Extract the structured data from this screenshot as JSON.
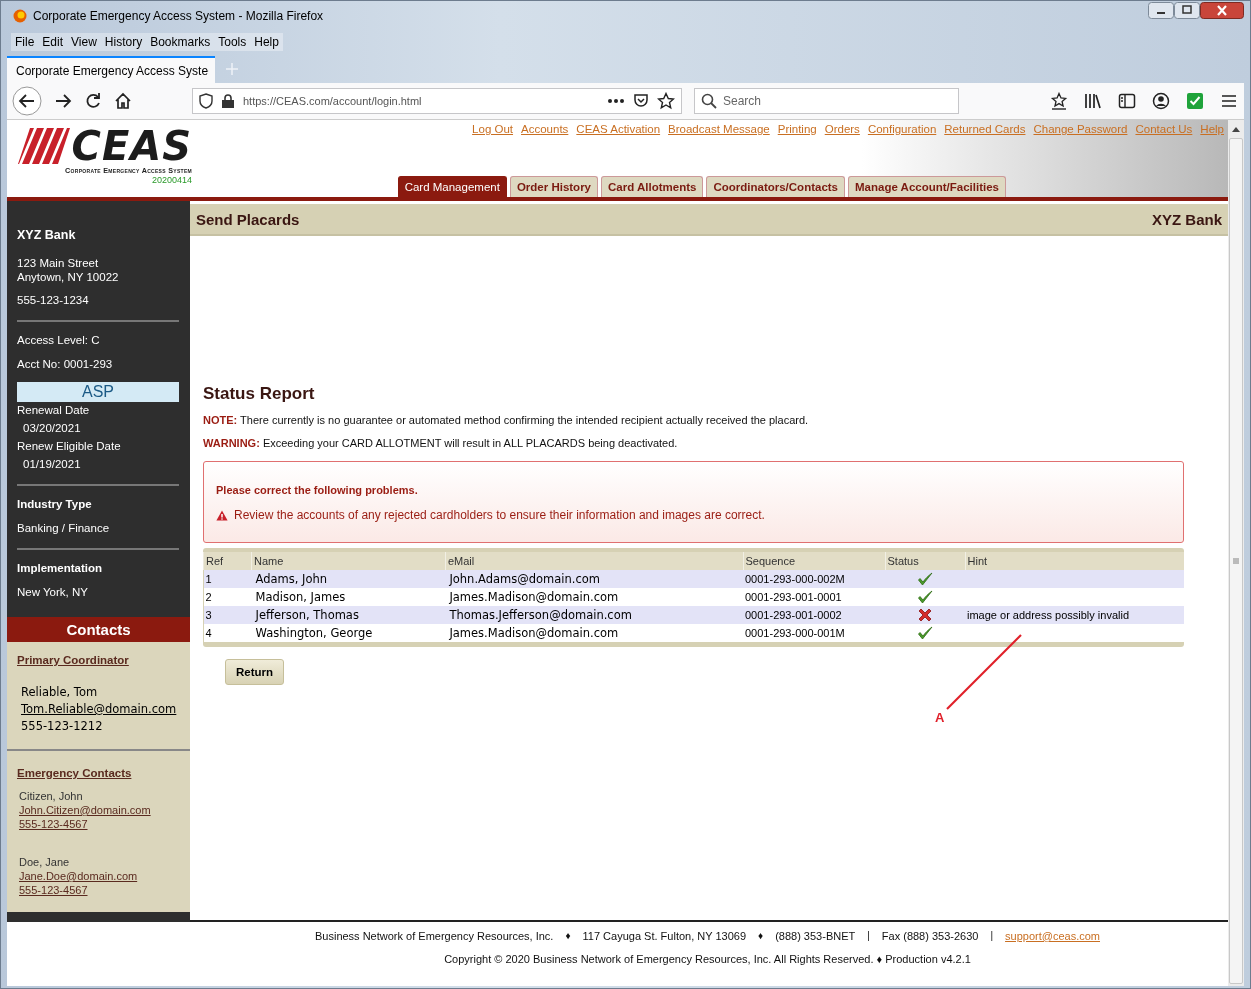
{
  "window": {
    "title": "Corporate Emergency Access System - Mozilla Firefox"
  },
  "menu": [
    "File",
    "Edit",
    "View",
    "History",
    "Bookmarks",
    "Tools",
    "Help"
  ],
  "browser_tab": {
    "label": "Corporate Emergency Access Syste",
    "selected": true
  },
  "nav": {
    "url": "https://CEAS.com/account/login.html",
    "search_placeholder": "Search"
  },
  "header": {
    "logo": "CEAS",
    "logo_subtitle": "Corporate Emergency Access System",
    "version": "20200414",
    "links": [
      "Log Out",
      "Accounts",
      "CEAS Activation",
      "Broadcast Message",
      "Printing",
      "Orders",
      "Configuration",
      "Returned Cards",
      "Change Password",
      "Contact Us",
      "Help"
    ],
    "tabs": [
      {
        "label": "Card Management",
        "selected": true
      },
      {
        "label": "Order History",
        "selected": false
      },
      {
        "label": "Card Allotments",
        "selected": false
      },
      {
        "label": "Coordinators/Contacts",
        "selected": false
      },
      {
        "label": "Manage Account/Facilities",
        "selected": false
      }
    ]
  },
  "page_title": "Send Placards",
  "account_name": "XYZ Bank",
  "sidebar": {
    "name": "XYZ Bank",
    "address": [
      "123 Main Street",
      "Anytown, NY 10022"
    ],
    "phone": "555-123-1234",
    "access_level": "Access Level: C",
    "acct_no": "Acct No: 0001-293",
    "badge": "ASP",
    "renewal_label": "Renewal Date",
    "renewal_date": "03/20/2021",
    "eligible_label": "Renew Eligible Date",
    "eligible_date": "01/19/2021",
    "industry_label": "Industry Type",
    "industry": "Banking / Finance",
    "impl_label": "Implementation",
    "impl": "New York, NY"
  },
  "contacts": {
    "title": "Contacts",
    "primary_label": "Primary Coordinator",
    "primary": {
      "name": "Reliable, Tom",
      "email": "Tom.Reliable@domain.com",
      "phone": "555-123-1212"
    },
    "emergency_label": "Emergency Contacts",
    "emergency": [
      {
        "name": "Citizen, John",
        "email": "John.Citizen@domain.com",
        "phone": "555-123-4567"
      },
      {
        "name": "Doe, Jane",
        "email": "Jane.Doe@domain.com",
        "phone": "555-123-4567"
      }
    ]
  },
  "report": {
    "title": "Status Report",
    "note_label": "NOTE:",
    "note": "There currently is no guarantee or automated method confirming the intended recipient actually received the placard.",
    "warning_label": "WARNING:",
    "warning": "Exceeding your CARD ALLOTMENT will result in ALL PLACARDS being deactivated.",
    "alert_title": "Please correct the following problems.",
    "alert_message": "Review the accounts of any rejected cardholders to ensure their information and images are correct.",
    "columns": [
      "Ref",
      "Name",
      "eMail",
      "Sequence",
      "Status",
      "Hint"
    ],
    "rows": [
      {
        "ref": "1",
        "name": "Adams, John",
        "email": "John.Adams@domain.com",
        "sequence": "0001-293-000-002M",
        "accepted": true
      },
      {
        "ref": "2",
        "name": "Madison, James",
        "email": "James.Madison@domain.com",
        "sequence": "0001-293-001-0001",
        "accepted": true
      },
      {
        "ref": "3",
        "name": "Jefferson, Thomas",
        "email": "Thomas.Jefferson@domain.com",
        "sequence": "0001-293-001-0002",
        "accepted": false,
        "hint": "image or address possibly invalid"
      },
      {
        "ref": "4",
        "name": "Washington, George",
        "email": "James.Madison@domain.com",
        "sequence": "0001-293-000-001M",
        "accepted": true
      }
    ],
    "button": "Return"
  },
  "annotation": {
    "label": "A"
  },
  "footer": {
    "items": [
      {
        "kind": "text",
        "text": "Business Network of Emergency Resources, Inc."
      },
      {
        "kind": "sep",
        "text": "♦"
      },
      {
        "kind": "text",
        "text": "117 Cayuga St. Fulton, NY 13069"
      },
      {
        "kind": "sep",
        "text": "♦"
      },
      {
        "kind": "text",
        "text": "(888) 353-BNET"
      },
      {
        "kind": "sep",
        "text": "|"
      },
      {
        "kind": "text",
        "text": "Fax (888) 353-2630"
      },
      {
        "kind": "sep",
        "text": "|"
      },
      {
        "kind": "link",
        "text": "support@ceas.com"
      }
    ],
    "copyright": "Copyright © 2020 Business Network of Emergency Resources, Inc. All Rights Reserved. ♦ Production v4.2.1"
  }
}
